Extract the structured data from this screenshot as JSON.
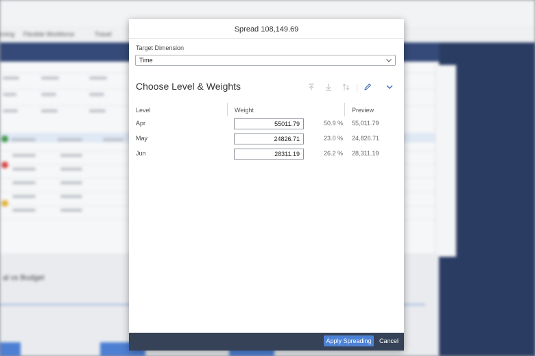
{
  "dialog": {
    "title": "Spread 108,149.69",
    "target_dimension_label": "Target Dimension",
    "target_dimension_value": "Time",
    "section_title": "Choose Level & Weights",
    "columns": {
      "level": "Level",
      "weight": "Weight",
      "preview": "Preview"
    },
    "rows": [
      {
        "level": "Apr",
        "weight": "55011.79",
        "percent": "50.9 %",
        "preview": "55,011.79"
      },
      {
        "level": "May",
        "weight": "24826.71",
        "percent": "23.0 %",
        "preview": "24,826.71"
      },
      {
        "level": "Jun",
        "weight": "28311.19",
        "percent": "26.2 %",
        "preview": "28,311.19"
      }
    ],
    "apply_label": "Apply Spreading",
    "cancel_label": "Cancel"
  },
  "background": {
    "tabs": [
      "Planning",
      "Flexible Workforce",
      "Travel"
    ],
    "lower_title": "al vs Budget"
  },
  "colors": {
    "accent": "#4d83d6",
    "footer": "#354257",
    "dark_band": "#2b3c63"
  }
}
